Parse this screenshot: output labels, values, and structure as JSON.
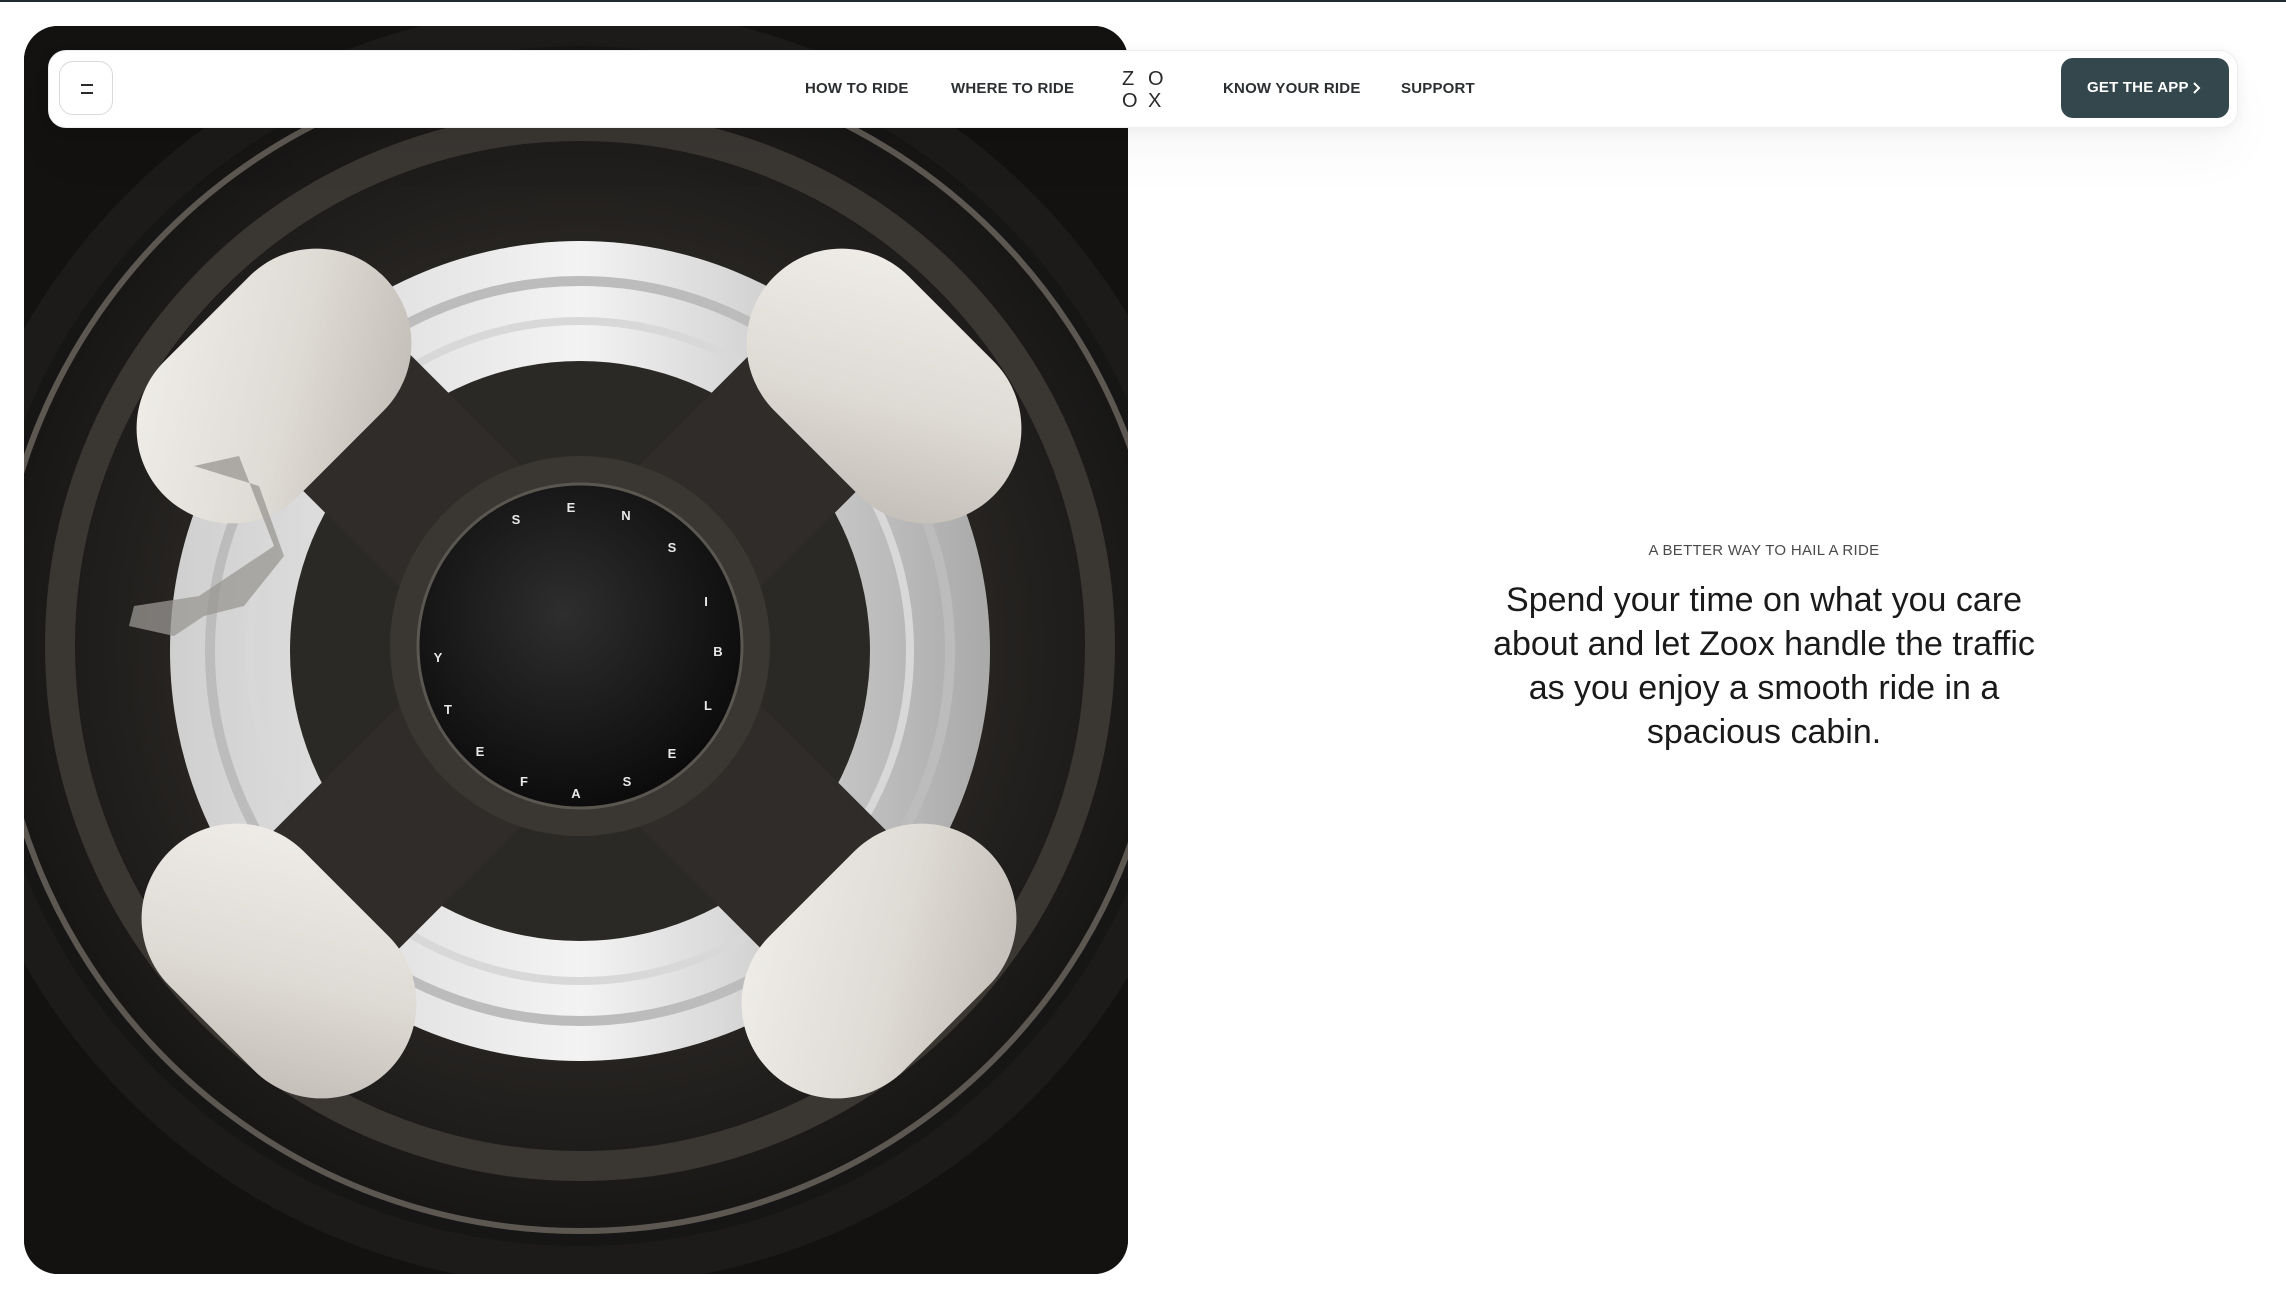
{
  "nav": {
    "menu_icon": "menu-icon",
    "links": [
      "HOW TO RIDE",
      "WHERE TO RIDE",
      "KNOW YOUR RIDE",
      "SUPPORT"
    ],
    "logo_letters": [
      "Z",
      "O",
      "O",
      "X"
    ],
    "cta_label": "GET THE APP",
    "cta_icon": "chevron-right-icon"
  },
  "hero": {
    "image": "zoox wheel close-up",
    "hub_text": "SENSIBLE SAFETY"
  },
  "content": {
    "eyebrow": "A BETTER WAY TO HAIL A RIDE",
    "headline_lines": [
      "Spend your time on what you care",
      "about and let Zoox handle the traffic",
      "as you enjoy a smooth ride in a",
      "spacious cabin."
    ]
  },
  "colors": {
    "cta_bg": "#34474c",
    "text": "#1a1a1a",
    "top_strip": "#1f2c33"
  }
}
